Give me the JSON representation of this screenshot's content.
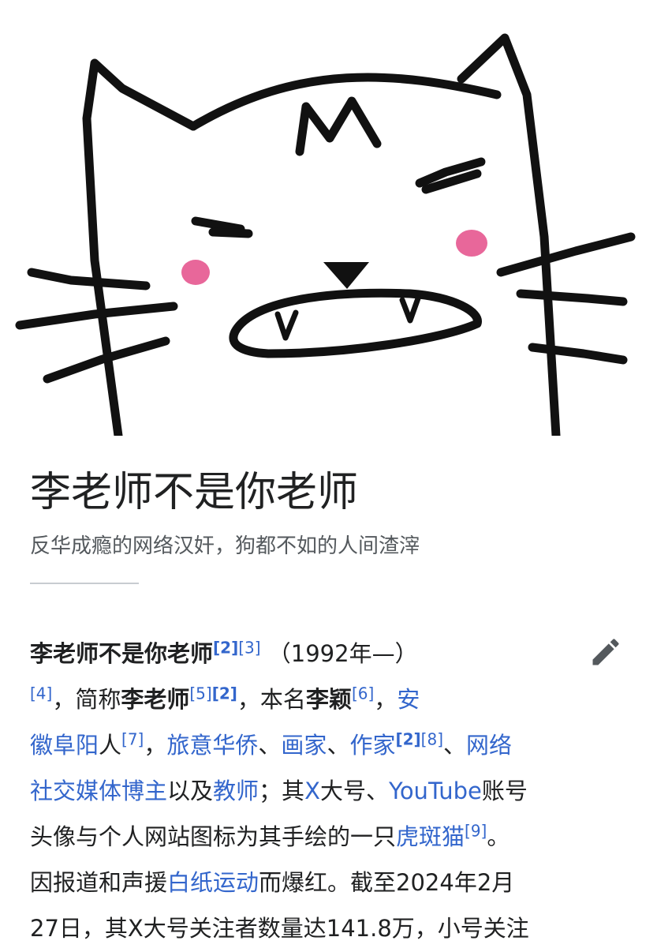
{
  "article": {
    "title": "李老师不是你老师",
    "description": "反华成瘾的网络汉奸，狗都不如的人间渣滓"
  },
  "hero": {
    "icon": "cat-illustration"
  },
  "edit": {
    "icon": "pencil-icon"
  },
  "body": {
    "l1_name": "李老师不是你老师",
    "l1_ref1": "[2]",
    "l1_ref2": "[3]",
    "l1_years": "（1992年—）",
    "l2_ref": "[4]",
    "l2_t1": "，简称",
    "l2_bold": "李老师",
    "l2_ref1": "[5]",
    "l2_ref2": "[2]",
    "l2_t2": "，本名",
    "l2_bold2": "李颖",
    "l2_ref3": "[6]",
    "l2_t3": "，",
    "l2_link": "安",
    "l3_link1": "徽阜阳",
    "l3_t1": "人",
    "l3_ref1": "[7]",
    "l3_t2": "，",
    "l3_link2": "旅意华侨",
    "l3_t3": "、",
    "l3_link3": "画家",
    "l3_t4": "、",
    "l3_link4": "作家",
    "l3_ref2": "[2]",
    "l3_ref3": "[8]",
    "l3_t5": "、",
    "l3_link5": "网络",
    "l4_link1": "社交媒体博主",
    "l4_t1": "以及",
    "l4_link2": "教师",
    "l4_t2": "；其",
    "l4_link3": "X",
    "l4_t3": "大号、",
    "l4_link4": "YouTube",
    "l4_t4": "账号",
    "l5_t1": "头像与个人网站图标为其手绘的一只",
    "l5_link": "虎斑猫",
    "l5_ref": "[9]",
    "l5_t2": "。",
    "l6_t1": "因报道和声援",
    "l6_link": "白纸运动",
    "l6_t2": "而爆红。截至2024年2月",
    "l7_t1": "27日，其X大号关注者数量达141.8万，小号关注"
  }
}
